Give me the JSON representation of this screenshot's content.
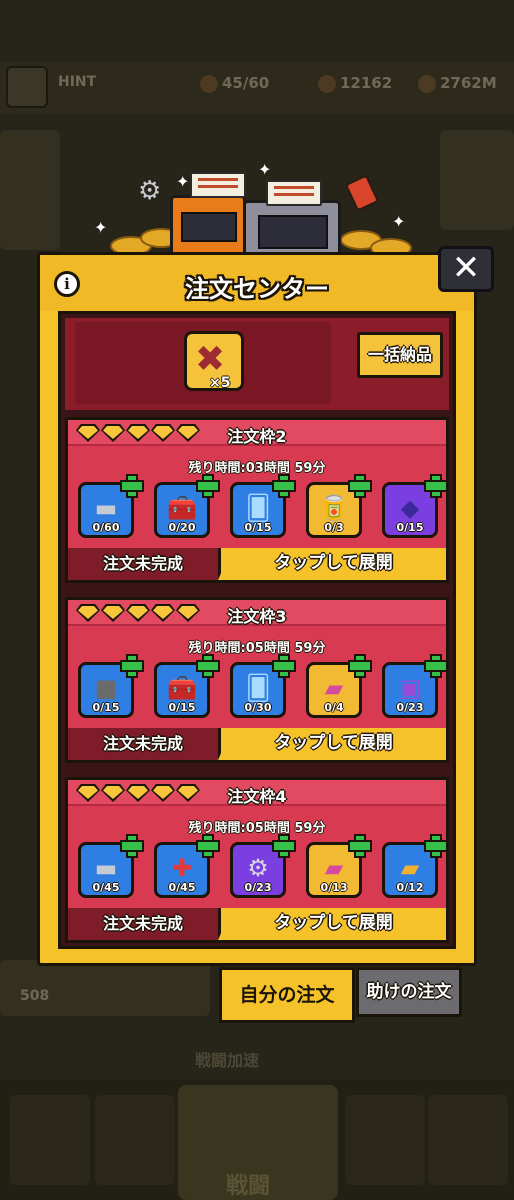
{
  "background": {
    "player_name": "HINT",
    "stamina": "45/60",
    "coins": "12162",
    "gems": "2762M",
    "left_counter": "508",
    "bottom_caption": "戦闘加速",
    "center_tab_label": "戦闘"
  },
  "modal": {
    "title": "注文センター",
    "info_label": "i",
    "close_label": "✕",
    "reward": {
      "multiplier": "×5",
      "icon": "skull-crossbones-icon"
    },
    "bulk_button": "一括納品",
    "orders": [
      {
        "title": "注文枠2",
        "time": "残り時間:03時間 59分",
        "status": "注文未完成",
        "expand": "タップして展開",
        "items": [
          {
            "icon": "steel-ingot-icon",
            "count": "0/60",
            "color": "blue",
            "glyph": "▬"
          },
          {
            "icon": "green-toolbox-icon",
            "count": "0/20",
            "color": "blue",
            "glyph": "🧰"
          },
          {
            "icon": "blue-card-icon",
            "count": "0/15",
            "color": "blue",
            "glyph": "🂠"
          },
          {
            "icon": "fuel-can-icon",
            "count": "0/3",
            "color": "gold",
            "glyph": "🥫"
          },
          {
            "icon": "purple-crystal-icon",
            "count": "0/15",
            "color": "purple",
            "glyph": "◆"
          }
        ]
      },
      {
        "title": "注文枠3",
        "time": "残り時間:05時間 59分",
        "status": "注文未完成",
        "expand": "タップして展開",
        "items": [
          {
            "icon": "iron-cube-icon",
            "count": "0/15",
            "color": "blue",
            "glyph": "■"
          },
          {
            "icon": "green-toolbox-icon",
            "count": "0/15",
            "color": "blue",
            "glyph": "🧰"
          },
          {
            "icon": "blue-card-icon",
            "count": "0/30",
            "color": "blue",
            "glyph": "🂠"
          },
          {
            "icon": "pink-chip-icon",
            "count": "0/4",
            "color": "gold",
            "glyph": "▰"
          },
          {
            "icon": "purple-chest-icon",
            "count": "0/23",
            "color": "blue",
            "glyph": "▣"
          }
        ]
      },
      {
        "title": "注文枠4",
        "time": "残り時間:05時間 59分",
        "status": "注文未完成",
        "expand": "タップして展開",
        "items": [
          {
            "icon": "steel-ingot-icon",
            "count": "0/45",
            "color": "blue",
            "glyph": "▬"
          },
          {
            "icon": "first-aid-kit-icon",
            "count": "0/45",
            "color": "blue",
            "glyph": "✚"
          },
          {
            "icon": "gear-icon",
            "count": "0/23",
            "color": "purple",
            "glyph": "⚙"
          },
          {
            "icon": "pink-chip-icon",
            "count": "0/13",
            "color": "gold",
            "glyph": "▰"
          },
          {
            "icon": "gold-bar-icon",
            "count": "0/12",
            "color": "blue",
            "glyph": "▰"
          }
        ]
      }
    ]
  },
  "tabs": {
    "mine": "自分の注文",
    "help": "助けの注文"
  },
  "colors": {
    "modal_yellow": "#f5c22a",
    "card_red": "#d83a52",
    "dark_red": "#7e1c2a",
    "outline": "#1b1408"
  }
}
